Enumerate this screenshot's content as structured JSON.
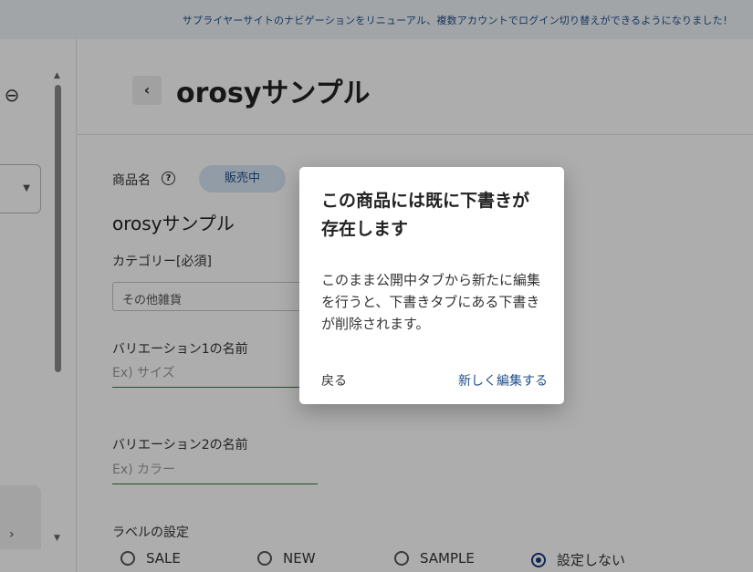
{
  "banner": {
    "text": "サプライヤーサイトのナビゲーションをリニューアル、複数アカウントでログイン切り替えができるようになりました！"
  },
  "header": {
    "title": "orosyサンプル"
  },
  "form": {
    "product_name_label": "商品名",
    "status_badge": "販売中",
    "product_name_value": "orosyサンプル",
    "category_label": "カテゴリー[必須]",
    "category_value": "その他雑貨",
    "variation1_label": "バリエーション1の名前",
    "variation1_placeholder": "Ex) サイズ",
    "variation2_label": "バリエーション2の名前",
    "variation2_placeholder": "Ex) カラー",
    "label_setting_title": "ラベルの設定",
    "label_options": [
      "SALE",
      "NEW",
      "SAMPLE",
      "設定しない"
    ],
    "label_selected": "設定しない"
  },
  "dialog": {
    "title": "この商品には既に下書きが存在します",
    "body": "このまま公開中タブから新たに編集を行うと、下書きタブにある下書きが削除されます。",
    "cancel_label": "戻る",
    "confirm_label": "新しく編集する"
  },
  "icons": {
    "back_circle": "arrow-left-circle-icon",
    "back": "chevron-left-icon",
    "help": "question-circle-icon",
    "dropdown": "caret-down-icon",
    "sidebar_expand": "chevron-right-icon"
  },
  "colors": {
    "accent": "#1f4f8a",
    "badge_bg": "#d8e6f5",
    "input_underline": "#2e7d32",
    "radio_selected": "#1a3a7a"
  }
}
